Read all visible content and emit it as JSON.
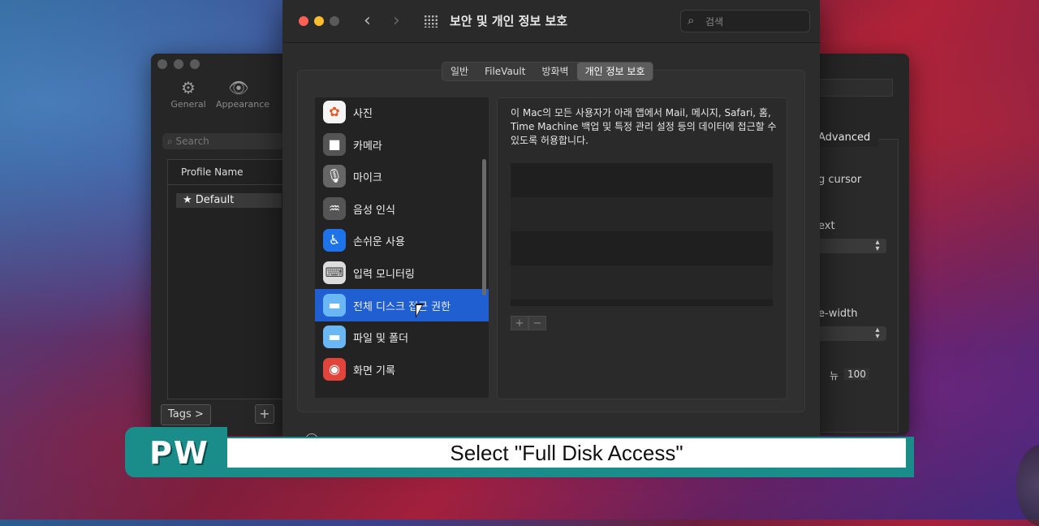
{
  "caption": {
    "logo": "PW",
    "text": "Select \"Full Disk Access\""
  },
  "left_window": {
    "toolbar": [
      {
        "label": "General",
        "icon": "gear-icon"
      },
      {
        "label": "Appearance",
        "icon": "eye-icon"
      }
    ],
    "search_placeholder": "Search",
    "table_header": "Profile Name",
    "row": "★ Default",
    "tags_button": "Tags >",
    "add_button": "+"
  },
  "right_window": {
    "tab": "Advanced",
    "labels": [
      "g cursor",
      "ext",
      "e-width"
    ],
    "spin_label": "뉴",
    "spin_value": "100"
  },
  "main_window": {
    "title": "보안 및 개인 정보 보호",
    "nav_back": "‹",
    "nav_forward": "›",
    "search_placeholder": "검색",
    "tabs": [
      "일반",
      "FileVault",
      "방화벽",
      "개인 정보 보호"
    ],
    "active_tab": "개인 정보 보호",
    "list": [
      {
        "label": "사진",
        "icon": "photos-icon",
        "color": "#f5f5f5"
      },
      {
        "label": "카메라",
        "icon": "camera-icon",
        "color": "#555555"
      },
      {
        "label": "마이크",
        "icon": "microphone-icon",
        "color": "#666666"
      },
      {
        "label": "음성 인식",
        "icon": "speech-recognition-icon",
        "color": "#555555"
      },
      {
        "label": "손쉬운 사용",
        "icon": "accessibility-icon",
        "color": "#1e73e8"
      },
      {
        "label": "입력 모니터링",
        "icon": "keyboard-icon",
        "color": "#dddddd"
      },
      {
        "label": "전체 디스크 접근 권한",
        "icon": "folder-icon",
        "color": "#6ab7f5"
      },
      {
        "label": "파일 및 폴더",
        "icon": "folder-icon",
        "color": "#6ab7f5"
      },
      {
        "label": "화면 기록",
        "icon": "screen-recording-icon",
        "color": "#e0443a"
      }
    ],
    "selected_index": 6,
    "description": "이 Mac의 모든 사용자가 아래 앱에서 Mail, 메시지, Safari, 홈, Time Machine 백업 및 특정 관리 설정 등의 데이터에 접근할 수 있도록 허용합니다.",
    "add_label": "+",
    "remove_label": "−",
    "accent": "#1f5fd1"
  }
}
